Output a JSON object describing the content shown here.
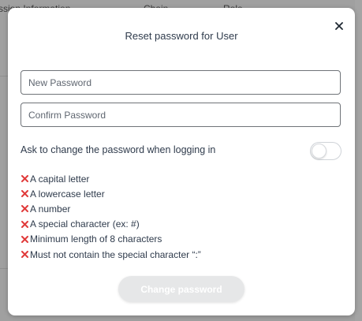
{
  "background": {
    "columns": [
      "ssion Information",
      "Chain",
      "Role"
    ]
  },
  "dialog": {
    "title": "Reset password for User",
    "close_icon": "close-icon",
    "new_password": {
      "placeholder": "New Password",
      "value": ""
    },
    "confirm_password": {
      "placeholder": "Confirm Password",
      "value": ""
    },
    "toggle": {
      "label": "Ask to change the password when logging in",
      "on": false
    },
    "rules_icon": "x-mark-icon",
    "rules_icon_color": "#e03a3a",
    "rules": [
      "A capital letter",
      "A lowercase letter",
      "A number",
      "A special character (ex: #)",
      "Minimum length of 8 characters",
      "Must not contain the special character “:”"
    ],
    "submit_label": "Change password",
    "submit_disabled": true
  }
}
